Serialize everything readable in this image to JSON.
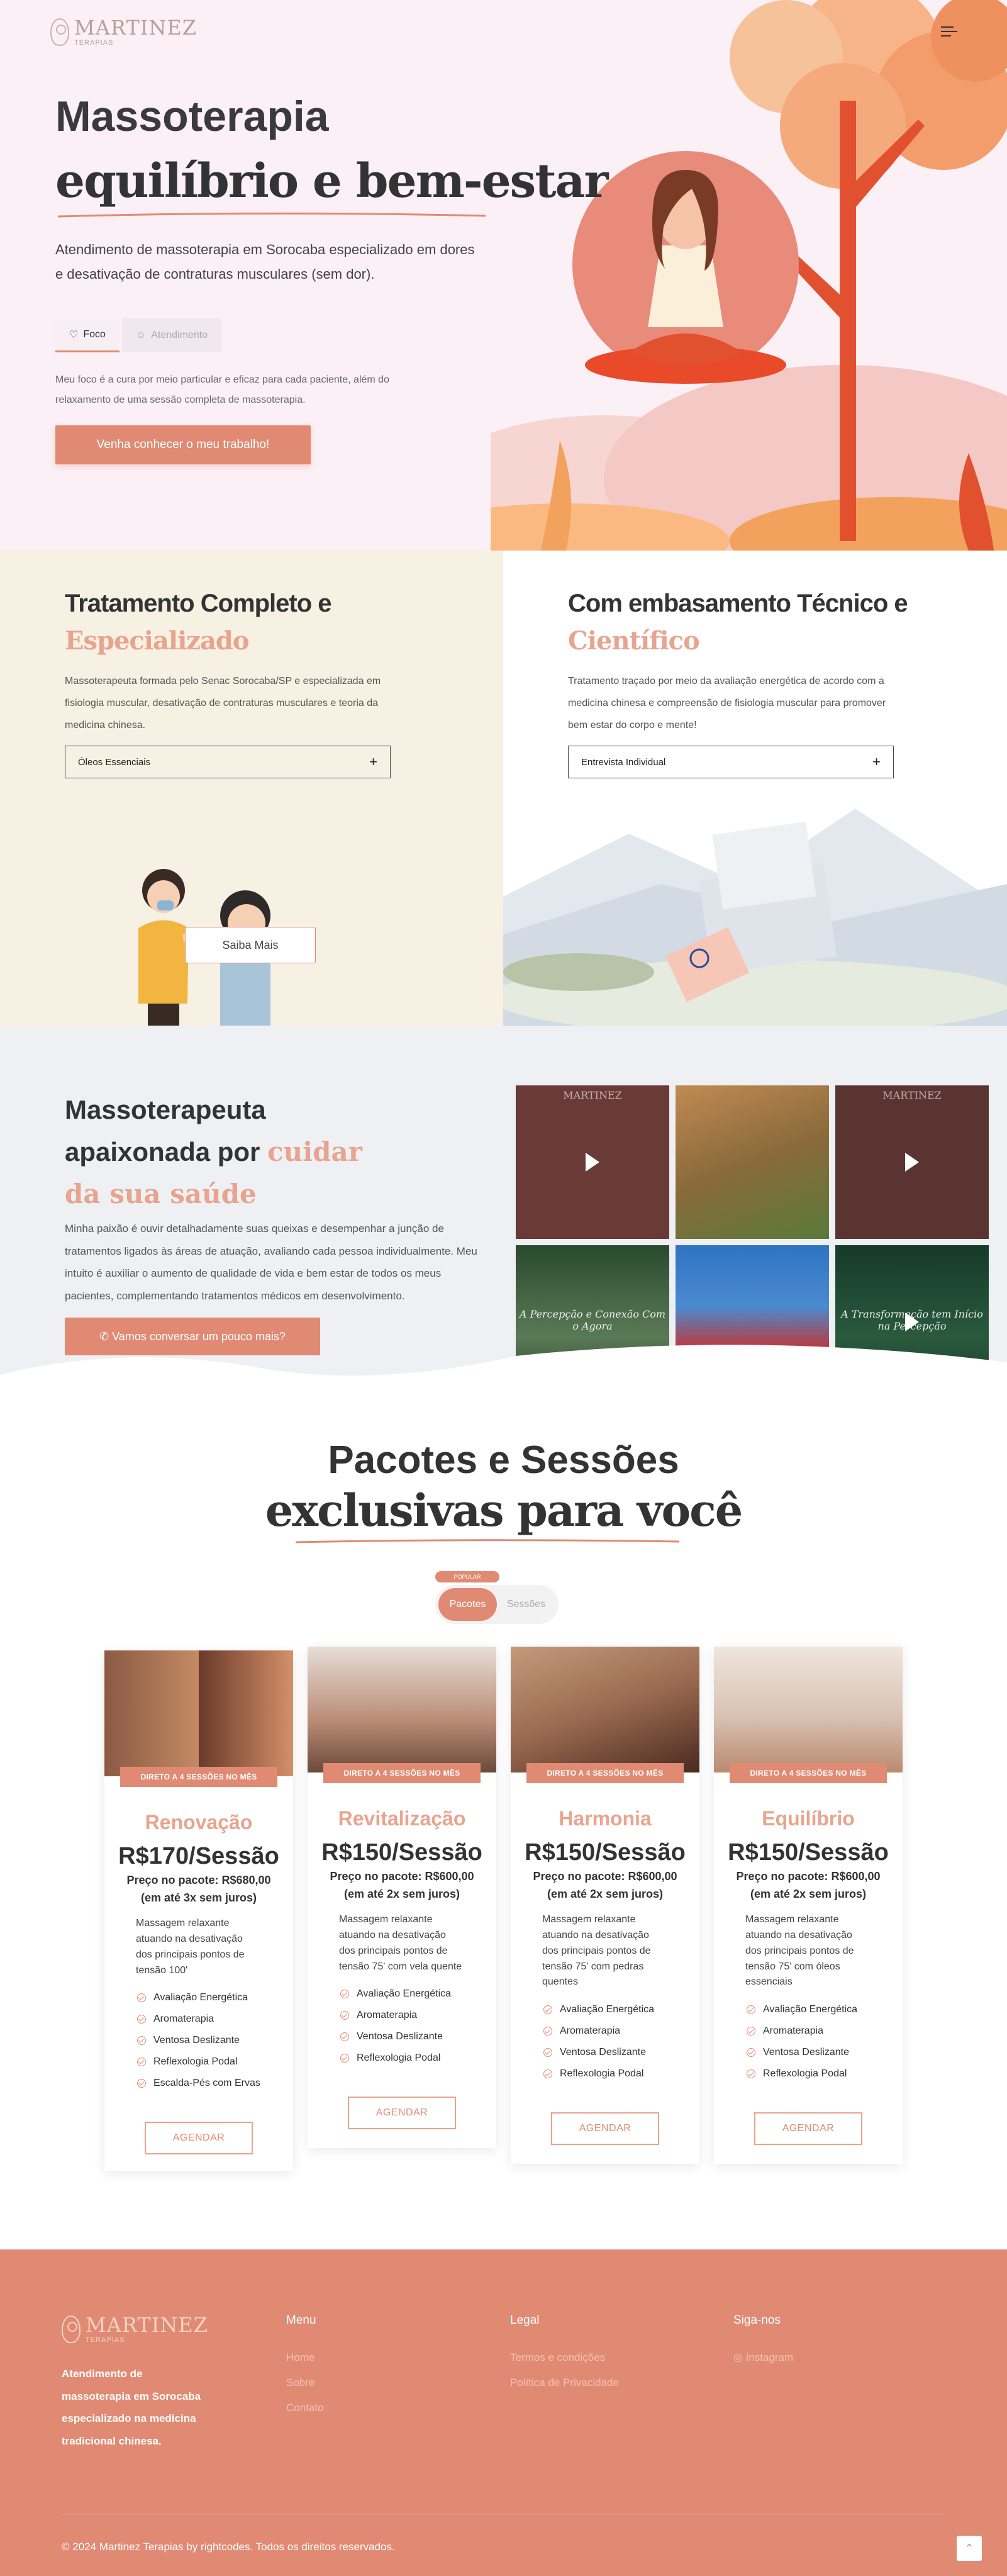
{
  "brand": {
    "name": "MARTINEZ",
    "sub": "TERAPIAS"
  },
  "hero": {
    "title": "Massoterapia",
    "title_emphasis": "equilíbrio e bem-estar",
    "description": "Atendimento de massoterapia em Sorocaba especializado em dores e desativação de contraturas musculares (sem dor).",
    "tabs": [
      {
        "label": "Foco",
        "icon": "heart-icon"
      },
      {
        "label": "Atendimento",
        "icon": "smiley-icon"
      }
    ],
    "note": "Meu foco é a cura por meio particular e eficaz para cada paciente, além do relaxamento de uma sessão completa de massoterapia.",
    "cta": "Venha conhecer o meu trabalho!"
  },
  "split": {
    "left": {
      "title": "Tratamento Completo e",
      "title_emphasis": "Especializado",
      "description": "Massoterapeuta formada pelo Senac Sorocaba/SP e especializada em fisiologia muscular, desativação de contraturas musculares e teoria da medicina chinesa.",
      "dropdown": "Óleos Essenciais",
      "button": "Saiba Mais"
    },
    "right": {
      "title": "Com embasamento Técnico e",
      "title_emphasis": "Científico",
      "description": "Tratamento traçado por meio da avaliação energética de acordo com a medicina chinesa e compreensão de fisiologia muscular para promover bem estar do corpo e mente!",
      "dropdown": "Entrevista Individual"
    }
  },
  "passion": {
    "title": "Massoterapeuta apaixonada por",
    "title_emphasis": "cuidar da sua saúde",
    "description": "Minha paixão é ouvir detalhadamente suas queixas e desempenhar a junção de tratamentos ligados às áreas de atuação, avaliando cada pessoa individualmente. Meu intuito é auxiliar o aumento de qualidade de vida e bem estar de todos os meus pacientes, complementando tratamentos médicos em desenvolvimento.",
    "cta": "Vamos conversar um pouco mais?",
    "gallery": [
      {
        "type": "video",
        "caption": "",
        "bg": "#6a3a36"
      },
      {
        "type": "image",
        "caption": "",
        "bg": "#9a7a4a"
      },
      {
        "type": "video",
        "caption": "",
        "bg": "#5a3430"
      },
      {
        "type": "image",
        "caption": "A Percepção e Conexão Com o Agora",
        "bg": "#3c5a3e"
      },
      {
        "type": "image",
        "caption": "",
        "bg": "#2f73c2"
      },
      {
        "type": "video",
        "caption": "A Transformação tem Início na Percepção",
        "bg": "#1f4a33"
      }
    ]
  },
  "packages": {
    "title": "Pacotes e Sessões",
    "title_emphasis": "exclusivas para você",
    "popular_badge": "POPULAR",
    "toggle": [
      "Pacotes",
      "Sessões"
    ],
    "cards": [
      {
        "ribbon": "DIRETO A 4 SESSÕES NO MÊS",
        "name": "Renovação",
        "price": "R$170/Sessão",
        "package_price": "Preço no pacote: R$680,00",
        "installments": "(em até 3x sem juros)",
        "description": "Massagem relaxante atuando na desativação dos principais pontos de tensão 100'",
        "items": [
          "Avaliação Energética",
          "Aromaterapia",
          "Ventosa Deslizante",
          "Reflexologia Podal",
          "Escalda-Pés com Ervas"
        ],
        "button": "AGENDAR",
        "bg": "#8a5a44"
      },
      {
        "ribbon": "DIRETO A 4 SESSÕES NO MÊS",
        "name": "Revitalização",
        "price": "R$150/Sessão",
        "package_price": "Preço no pacote: R$600,00",
        "installments": "(em até 2x sem juros)",
        "description": "Massagem relaxante atuando na desativação dos principais pontos de tensão 75' com vela quente",
        "items": [
          "Avaliação Energética",
          "Aromaterapia",
          "Ventosa Deslizante",
          "Reflexologia Podal"
        ],
        "button": "AGENDAR",
        "bg": "#b98a74"
      },
      {
        "ribbon": "DIRETO A 4 SESSÕES NO MÊS",
        "name": "Harmonia",
        "price": "R$150/Sessão",
        "package_price": "Preço no pacote: R$600,00",
        "installments": "(em até 2x sem juros)",
        "description": "Massagem relaxante atuando na desativação dos principais pontos de tensão 75' com pedras quentes",
        "items": [
          "Avaliação Energética",
          "Aromaterapia",
          "Ventosa Deslizante",
          "Reflexologia Podal"
        ],
        "button": "AGENDAR",
        "bg": "#9a6a50"
      },
      {
        "ribbon": "DIRETO A 4 SESSÕES NO MÊS",
        "name": "Equilíbrio",
        "price": "R$150/Sessão",
        "package_price": "Preço no pacote: R$600,00",
        "installments": "(em até 2x sem juros)",
        "description": "Massagem relaxante atuando na desativação dos principais pontos de tensão 75' com óleos essenciais",
        "items": [
          "Avaliação Energética",
          "Aromaterapia",
          "Ventosa Deslizante",
          "Reflexologia Podal"
        ],
        "button": "AGENDAR",
        "bg": "#d9c2b4"
      }
    ]
  },
  "footer": {
    "about": "Atendimento de massoterapia em Sorocaba especializado na medicina tradicional chinesa.",
    "menu_title": "Menu",
    "menu": [
      "Home",
      "Sobre",
      "Contato"
    ],
    "legal_title": "Legal",
    "legal": [
      "Termos e condições",
      "Política de Privacidade"
    ],
    "social_title": "Siga-nos",
    "social": [
      "Instagram"
    ],
    "copyright": "© 2024 Martinez Terapias by rightcodes. Todos os direitos reservados."
  },
  "colors": {
    "accent": "#e08a74",
    "accent_light": "#e8a48e",
    "hero_bg": "#fbf0f6",
    "cream": "#f6f1e3",
    "footer": "#e08a74"
  }
}
